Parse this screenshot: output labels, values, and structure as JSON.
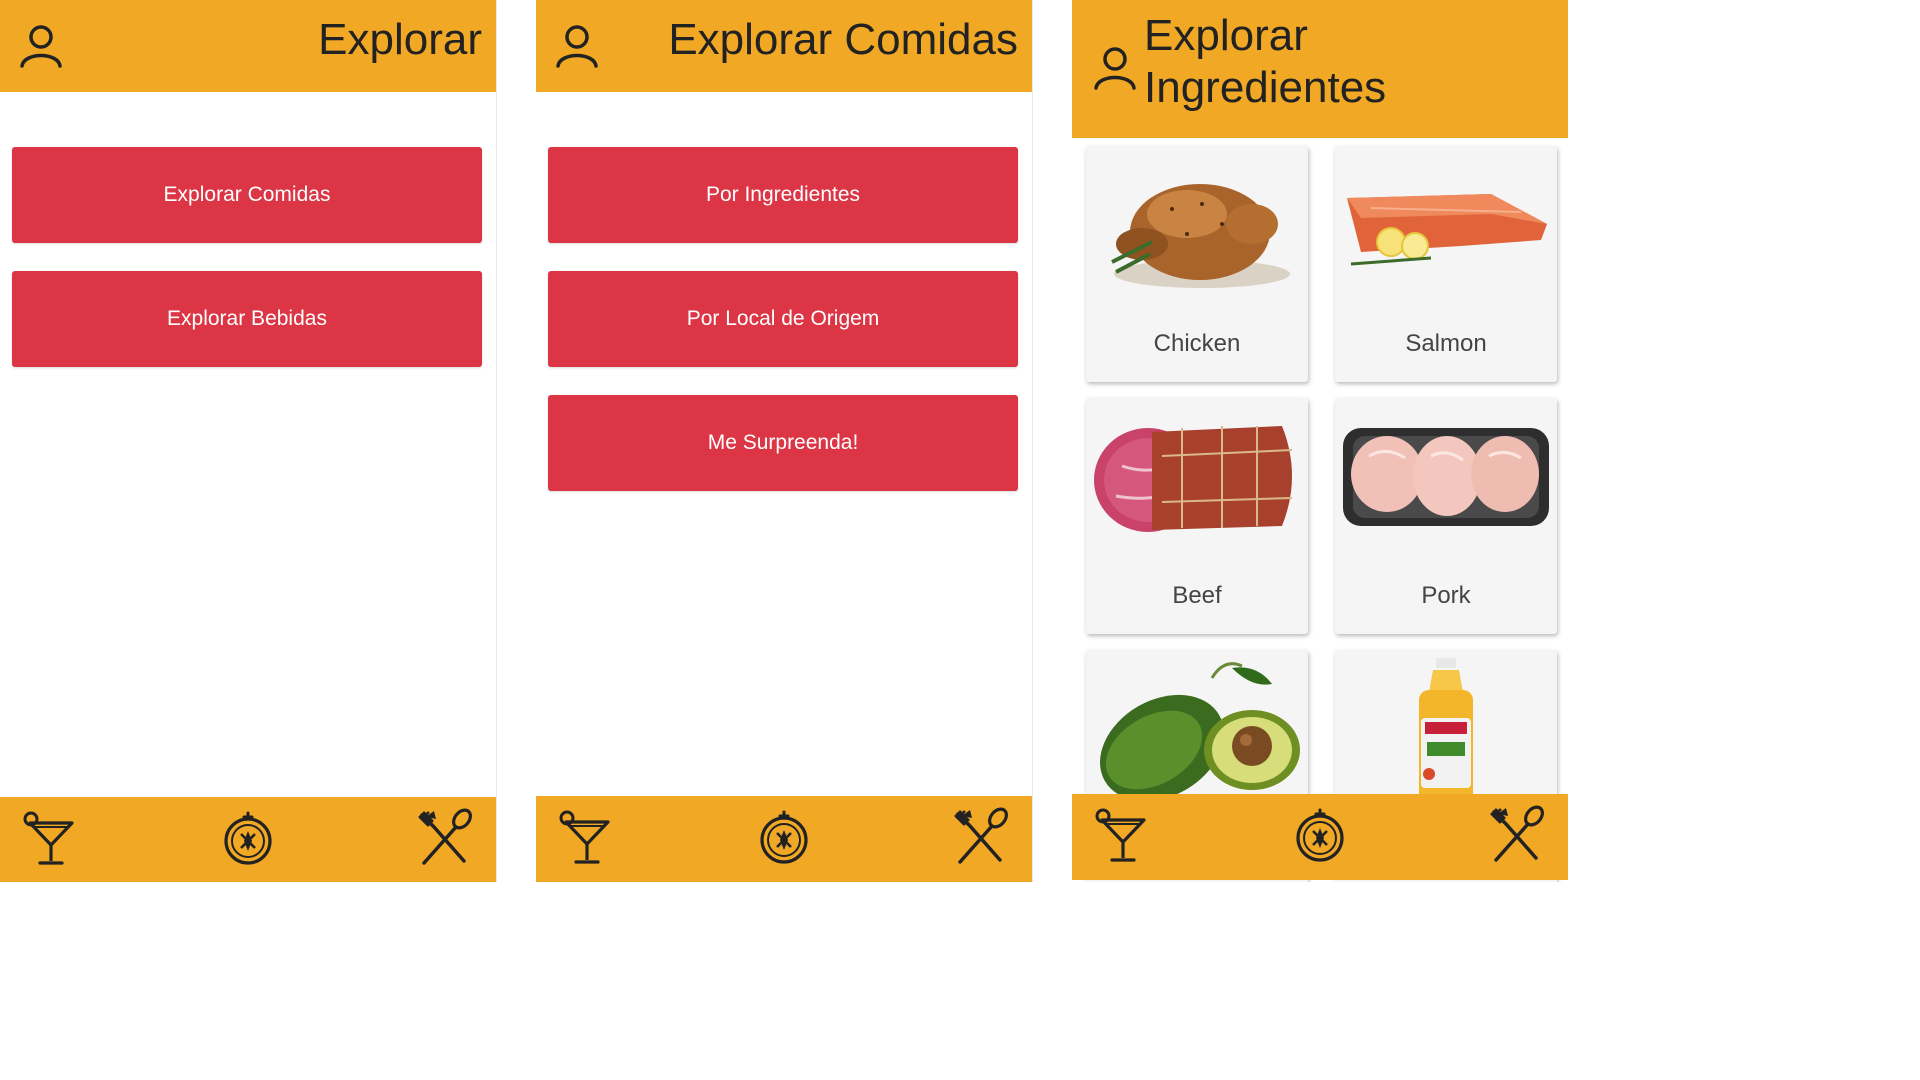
{
  "screens": [
    {
      "title": "Explorar",
      "buttons": [
        "Explorar Comidas",
        "Explorar Bebidas"
      ]
    },
    {
      "title": "Explorar Comidas",
      "buttons": [
        "Por Ingredientes",
        "Por Local de Origem",
        "Me Surpreenda!"
      ]
    },
    {
      "title": "Explorar Ingredientes",
      "ingredients": [
        "Chicken",
        "Salmon",
        "Beef",
        "Pork",
        "",
        ""
      ]
    }
  ],
  "colors": {
    "header": "#f0a825",
    "button": "#dc3545",
    "card": "#f5f5f5"
  },
  "icons": {
    "profile": "profile-icon",
    "drinks": "drinks-icon",
    "explore": "explore-icon",
    "food": "food-icon"
  }
}
